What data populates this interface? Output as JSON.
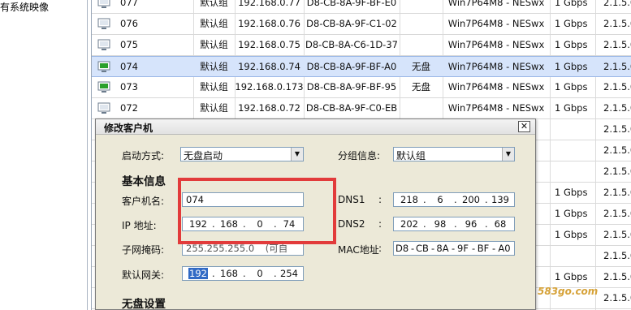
{
  "sidebar": {
    "label": "有系统映像"
  },
  "table": {
    "rows": [
      {
        "name": "077",
        "group": "默认组",
        "ip": "192.168.0.77",
        "mac": "D8-CB-8A-9F-BF-E0",
        "disk": "",
        "os": "Win7P64M8 - NESwx",
        "speed": "1 Gbps",
        "ver": "2.1.5.0",
        "state": "offline"
      },
      {
        "name": "076",
        "group": "默认组",
        "ip": "192.168.0.76",
        "mac": "D8-CB-8A-9F-C1-02",
        "disk": "",
        "os": "Win7P64M8 - NESwx",
        "speed": "1 Gbps",
        "ver": "2.1.5.0",
        "state": "offline"
      },
      {
        "name": "075",
        "group": "默认组",
        "ip": "192.168.0.75",
        "mac": "D8-CB-8A-C6-1D-37",
        "disk": "",
        "os": "Win7P64M8 - NESwx",
        "speed": "1 Gbps",
        "ver": "2.1.5.0",
        "state": "offline"
      },
      {
        "name": "074",
        "group": "默认组",
        "ip": "192.168.0.74",
        "mac": "D8-CB-8A-9F-BF-A0",
        "disk": "无盘",
        "os": "Win7P64M8 - NESwx",
        "speed": "1 Gbps",
        "ver": "2.1.5.0",
        "state": "online"
      },
      {
        "name": "073",
        "group": "默认组",
        "ip": "192.168.0.173",
        "mac": "D8-CB-8A-9F-BF-95",
        "disk": "无盘",
        "os": "Win7P64M8 - NESwx",
        "speed": "1 Gbps",
        "ver": "2.1.5.0",
        "state": "online"
      },
      {
        "name": "072",
        "group": "默认组",
        "ip": "192.168.0.72",
        "mac": "D8-CB-8A-9F-C0-EB",
        "disk": "",
        "os": "Win7P64M8 - NESwx",
        "speed": "1 Gbps",
        "ver": "2.1.5.0",
        "state": "offline"
      }
    ],
    "right_fragments": [
      {
        "speed": "",
        "ver": "2.1.5.0"
      },
      {
        "speed": "",
        "ver": "2.1.5.0"
      },
      {
        "speed": "",
        "ver": "2.1.5.0"
      },
      {
        "speed": "1 Gbps",
        "ver": "2.1.5.0"
      },
      {
        "speed": "1 Gbps",
        "ver": "2.1.5.0"
      },
      {
        "speed": "1 Gbps",
        "ver": "2.1.5.0"
      },
      {
        "speed": "",
        "ver": "2.1.5.0"
      },
      {
        "speed": "1 Gbps",
        "ver": "2.1.5.0"
      },
      {
        "speed": "",
        "ver": "2.1.5.0"
      }
    ]
  },
  "dialog": {
    "title": "修改客户机",
    "close": "✕",
    "boot_mode_label": "启动方式:",
    "boot_mode_value": "无盘启动",
    "group_label": "分组信息:",
    "group_value": "默认组",
    "basic_section": "基本信息",
    "name_label": "客户机名:",
    "name_value": "074",
    "ip_label": "IP  地址:",
    "ip": [
      "192",
      "168",
      "0",
      "74"
    ],
    "dns1_label": "DNS1",
    "dns1": [
      "218",
      "6",
      "200",
      "139"
    ],
    "dns2_label": "DNS2",
    "dns2": [
      "202",
      "98",
      "96",
      "68"
    ],
    "mask_label": "子网掩码:",
    "mask_value": "255.255.255.0",
    "mask_hint": "(可自",
    "mac_label": "MAC地址",
    "mac": [
      "D8",
      "CB",
      "8A",
      "9F",
      "BF",
      "A0"
    ],
    "gateway_label": "默认网关:",
    "gateway": [
      "192",
      "168",
      "0",
      "254"
    ],
    "diskless_section": "无盘设置",
    "colon": ":"
  },
  "watermark": "583go.com",
  "colors": {
    "selected_row": "#d6e4fb",
    "highlight_box": "#e23b3b",
    "dialog_bg": "#ece9d8",
    "online_icon": "#2aa02a"
  }
}
